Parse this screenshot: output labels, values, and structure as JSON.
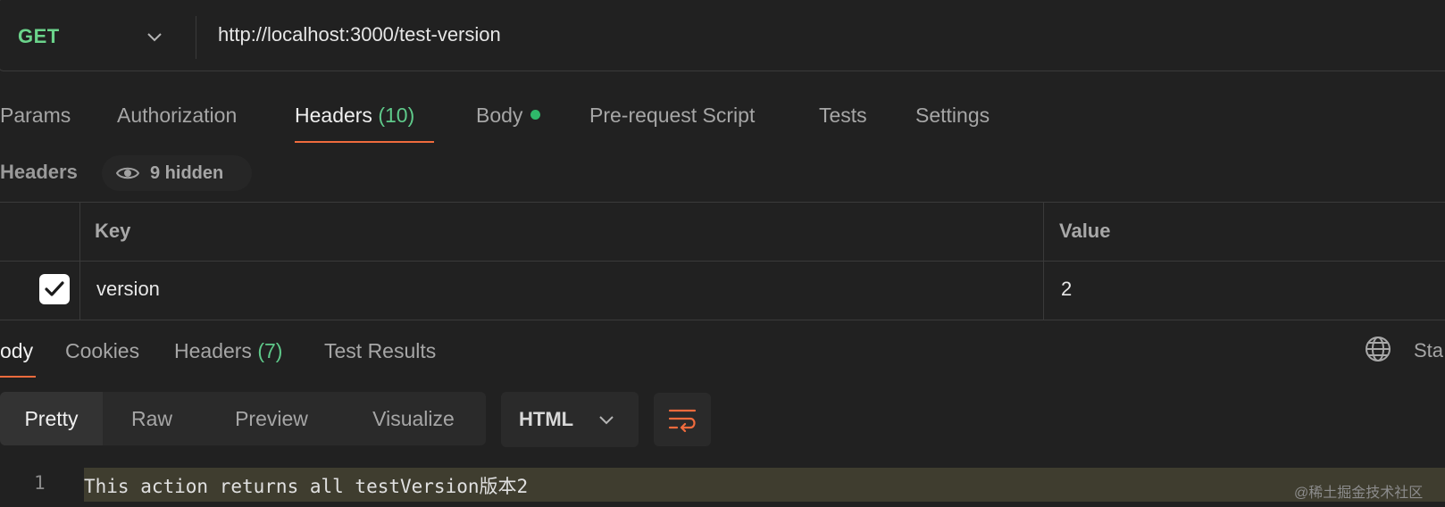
{
  "request": {
    "method": "GET",
    "url": "http://localhost:3000/test-version"
  },
  "request_tabs": [
    {
      "label": "Params"
    },
    {
      "label": "Authorization"
    },
    {
      "label": "Headers",
      "count": "(10)"
    },
    {
      "label": "Body"
    },
    {
      "label": "Pre-request Script"
    },
    {
      "label": "Tests"
    },
    {
      "label": "Settings"
    }
  ],
  "headers_section": {
    "title": "Headers",
    "hidden_text": "9 hidden"
  },
  "headers_table": {
    "columns": [
      "Key",
      "Value"
    ],
    "rows": [
      {
        "key": "version",
        "value": "2",
        "checked": true
      }
    ]
  },
  "response_tabs": [
    {
      "label": "ody"
    },
    {
      "label": "Cookies"
    },
    {
      "label": "Headers",
      "count": "(7)"
    },
    {
      "label": "Test Results"
    }
  ],
  "status_label": "Sta",
  "view_modes": [
    "Pretty",
    "Raw",
    "Preview",
    "Visualize"
  ],
  "format": "HTML",
  "code": {
    "line_number": "1",
    "line_text": "This action returns all testVersion版本2"
  },
  "watermark": "@稀土掘金技术社区",
  "colors": {
    "background": "#212121",
    "method_green": "#6bd48b",
    "accent_orange": "#f06b3d",
    "count_green": "#5fc98a",
    "dot_green": "#2fb86a"
  },
  "icons": {
    "method_dropdown": "chevron-down-icon",
    "hidden_toggle": "eye-icon",
    "checkbox": "checkmark-icon",
    "network": "globe-icon",
    "format_dropdown": "chevron-down-icon",
    "wrap": "wrap-lines-icon"
  }
}
